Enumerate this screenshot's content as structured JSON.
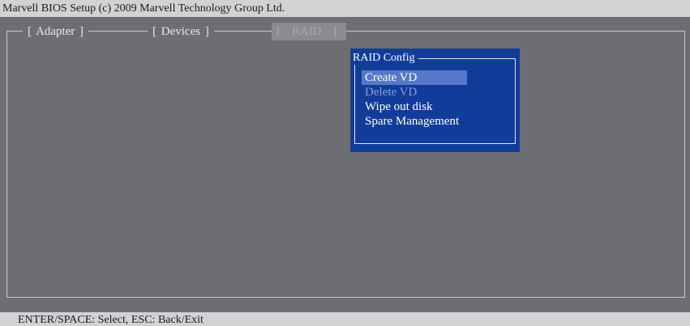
{
  "title_bar": {
    "text": "Marvell BIOS Setup (c) 2009 Marvell Technology Group Ltd."
  },
  "tabs": [
    {
      "label": "Adapter",
      "active": false
    },
    {
      "label": "Devices",
      "active": false
    },
    {
      "label": "RAID",
      "active": true
    }
  ],
  "raid_panel": {
    "title": "RAID Config",
    "items": [
      {
        "label": "Create VD",
        "state": "selected"
      },
      {
        "label": "Delete VD",
        "state": "disabled"
      },
      {
        "label": "Wipe out disk",
        "state": "normal"
      },
      {
        "label": "Spare Management",
        "state": "normal"
      }
    ]
  },
  "status_bar": {
    "text": "ENTER/SPACE: Select, ESC: Back/Exit"
  },
  "colors": {
    "background": "#6d6e72",
    "bars": "#d1d2d3",
    "panel": "#123c9a",
    "selection": "#5579c8",
    "active_tab": "#8a8b8e"
  }
}
